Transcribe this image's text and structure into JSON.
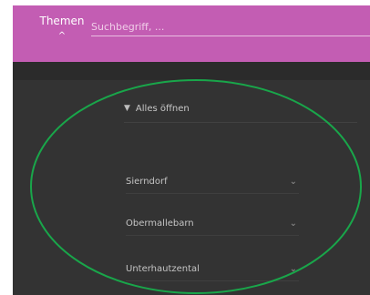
{
  "topbar": {
    "themes_tab": {
      "label": "Themen"
    },
    "caret_icon": "^",
    "search": {
      "placeholder": "Suchbegriff, ..."
    }
  },
  "panel": {
    "open_all": {
      "label": "Alles öffnen",
      "icon": "pin-icon"
    },
    "items": [
      {
        "label": "Sierndorf"
      },
      {
        "label": "Obermallebarn"
      },
      {
        "label": "Unterhautzental"
      }
    ]
  },
  "colors": {
    "topbar": "#c35db3",
    "panel": "#333333",
    "annotation": "#19a64a"
  }
}
